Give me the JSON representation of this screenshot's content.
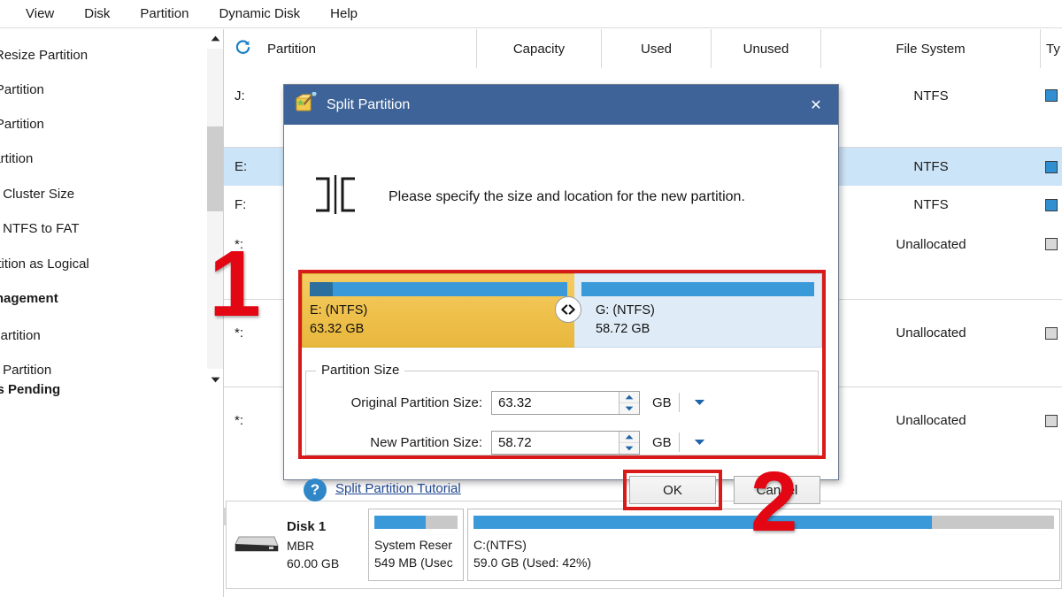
{
  "menubar": {
    "items": [
      {
        "label": "View"
      },
      {
        "label": "Disk"
      },
      {
        "label": "Partition"
      },
      {
        "label": "Dynamic Disk"
      },
      {
        "label": "Help"
      }
    ]
  },
  "sidebar": {
    "items": [
      {
        "label": "ve/Resize Partition",
        "group": false
      },
      {
        "label": "nd Partition",
        "group": false
      },
      {
        "label": "ge Partition",
        "group": false
      },
      {
        "label": "t Partition",
        "group": false
      },
      {
        "label": "nge Cluster Size",
        "group": false
      },
      {
        "label": "vert NTFS to FAT",
        "group": false
      },
      {
        "label": "Partition as Logical",
        "group": false
      },
      {
        "label": "Management",
        "group": true
      },
      {
        "label": "te Partition",
        "group": false
      },
      {
        "label": "mat Partition",
        "group": false
      },
      {
        "label": "ions Pending",
        "group": true
      }
    ]
  },
  "table": {
    "columns": [
      {
        "label": "Partition"
      },
      {
        "label": "Capacity"
      },
      {
        "label": "Used"
      },
      {
        "label": "Unused"
      },
      {
        "label": "File System"
      },
      {
        "label": "Ty"
      }
    ],
    "rows": [
      {
        "partition": "J:",
        "capacity": "",
        "used": "",
        "unused": "",
        "filesystem": "NTFS",
        "checkbox": "blue",
        "selected": false,
        "separator": false
      },
      {
        "partition": "E:",
        "capacity": "",
        "used": "",
        "unused": "",
        "filesystem": "NTFS",
        "checkbox": "blue",
        "selected": true,
        "separator": true
      },
      {
        "partition": "F:",
        "capacity": "",
        "used": "",
        "unused": "",
        "filesystem": "NTFS",
        "checkbox": "blue",
        "selected": false,
        "separator": false
      },
      {
        "partition": "*:",
        "capacity": "",
        "used": "",
        "unused": "",
        "filesystem": "Unallocated",
        "checkbox": "grey",
        "selected": false,
        "separator": false
      },
      {
        "partition": "*:",
        "capacity": "",
        "used": "",
        "unused": "",
        "filesystem": "Unallocated",
        "checkbox": "grey",
        "selected": false,
        "separator": true
      },
      {
        "partition": "*:",
        "capacity": "",
        "used": "",
        "unused": "",
        "filesystem": "Unallocated",
        "checkbox": "grey",
        "selected": false,
        "separator": true
      }
    ]
  },
  "disk_panel": {
    "name": "Disk 1",
    "scheme": "MBR",
    "size": "60.00 GB",
    "partitions": [
      {
        "label": "System Reser",
        "detail": "549 MB (Usec",
        "used_pct": 62
      },
      {
        "label": "C:(NTFS)",
        "detail": "59.0 GB (Used: 42%)",
        "used_pct": 79
      }
    ]
  },
  "dialog": {
    "title": "Split Partition",
    "close_label": "✕",
    "prompt": "Please specify the size and location for the new partition.",
    "bars": {
      "original": {
        "name": "E: (NTFS)",
        "size": "63.32 GB",
        "used_pct": 9
      },
      "new": {
        "name": "G: (NTFS)",
        "size": "58.72 GB",
        "used_pct": 0
      }
    },
    "group_title": "Partition Size",
    "fields": [
      {
        "label": "Original Partition Size:",
        "value": "63.32",
        "unit": "GB"
      },
      {
        "label": "New Partition Size:",
        "value": "58.72",
        "unit": "GB"
      }
    ],
    "help_mark": "?",
    "tutorial_link": "Split Partition Tutorial",
    "ok_label": "OK",
    "cancel_label": "Cancel"
  },
  "annotations": [
    {
      "label": "1"
    },
    {
      "label": "2"
    }
  ],
  "colors": {
    "title_bar": "#3d6398",
    "accent_blue": "#3a9ad9",
    "annotation_red": "#e30613",
    "highlight_row": "#cce4f7",
    "partition_orange": "#eec04a"
  }
}
